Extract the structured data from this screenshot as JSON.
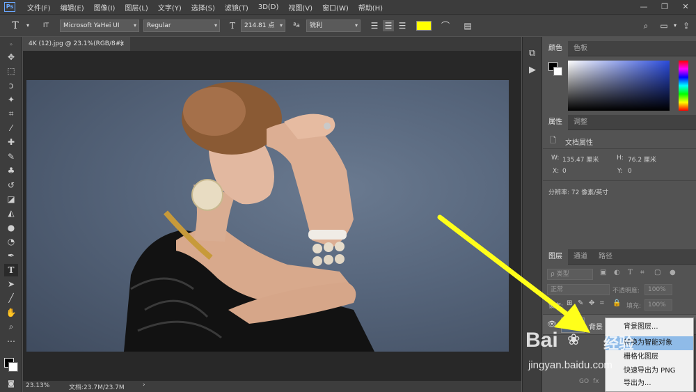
{
  "app": {
    "logo": "Ps",
    "menus": [
      "文件(F)",
      "编辑(E)",
      "图像(I)",
      "图层(L)",
      "文字(Y)",
      "选择(S)",
      "滤镜(T)",
      "3D(D)",
      "视图(V)",
      "窗口(W)",
      "帮助(H)"
    ],
    "window_controls": [
      "—",
      "❐",
      "✕"
    ]
  },
  "options": {
    "tool_glyph": "T",
    "orient_glyph": "IT",
    "font_family": "Microsoft YaHei UI",
    "font_style": "Regular",
    "font_size": "214.81 点",
    "aa_label": "ªa",
    "aa_mode": "锐利",
    "text_color": "#ffff00"
  },
  "document": {
    "tab_title": "4K (12).jpg @ 23.1%(RGB/8#)",
    "tab_close": "×",
    "zoom": "23.13%",
    "doc_info": "文档:23.7M/23.7M",
    "status_arrow": "›"
  },
  "panels": {
    "color_tabs": [
      "颜色",
      "色板"
    ],
    "properties_tabs": [
      "属性",
      "调整"
    ],
    "properties": {
      "doc_label": "文档属性",
      "w_label": "W:",
      "w_value": "135.47 厘米",
      "h_label": "H:",
      "h_value": "76.2 厘米",
      "x_label": "X:",
      "x_value": "0",
      "y_label": "Y:",
      "y_value": "0",
      "resolution": "分辨率: 72 像素/英寸"
    },
    "layers_tabs": [
      "图层",
      "通道",
      "路径"
    ],
    "layers": {
      "kind_filter": "ρ 类型",
      "blend_mode": "正常",
      "opacity_label": "不透明度:",
      "opacity_value": "100%",
      "lock_label": "锁定:",
      "fill_label": "填充:",
      "fill_value": "100%",
      "layer_name": "背景",
      "bottom_icons": [
        "GO",
        "fx"
      ]
    }
  },
  "context_menu": {
    "items": [
      "背景图层...",
      "转换为智能对象",
      "栅格化图层",
      "快速导出为 PNG",
      "导出为..."
    ],
    "selected_index": 1
  },
  "watermark": {
    "brand": "Bai",
    "brand_cn": "经验",
    "url": "jingyan.baidu.com"
  },
  "colors": {
    "arrow": "#ffff1a",
    "accent_selection": "#8fbbe8"
  }
}
